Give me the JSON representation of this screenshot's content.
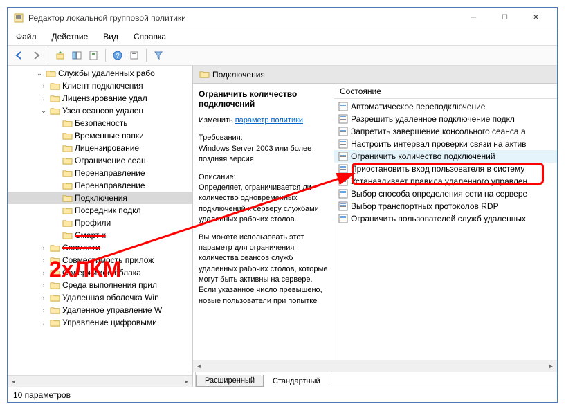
{
  "window": {
    "title": "Редактор локальной групповой политики"
  },
  "menu": {
    "file": "Файл",
    "action": "Действие",
    "view": "Вид",
    "help": "Справка"
  },
  "tree": {
    "root": "Службы удаленных рабо",
    "items": [
      "Клиент подключения",
      "Лицензирование удал",
      "Узел сеансов удален",
      "Безопасность",
      "Временные папки",
      "Лицензирование",
      "Ограничение сеан",
      "Перенаправление",
      "Перенаправление",
      "Подключения",
      "Посредник подкл",
      "Профили",
      "Смарт-к",
      "Совмести",
      "Совместимость прилож",
      "Содержимое облака",
      "Среда выполнения прил",
      "Удаленная оболочка Win",
      "Удаленное управление W",
      "Управление цифровыми"
    ],
    "sel_index": 9,
    "open_index": 2,
    "strike_a": 12,
    "strike_b": 13,
    "level2_start": 3,
    "level2_end": 12
  },
  "header": {
    "title": "Подключения"
  },
  "desc": {
    "title": "Ограничить количество подключений",
    "edit_label": "Изменить",
    "edit_link": "параметр политики",
    "req_h": "Требования:",
    "req_t": "Windows Server 2003 или более поздняя версия",
    "desc_h": "Описание:",
    "desc_t1": "Определяет, ограничивается ли количество одновременных подключений к серверу службами удаленных рабочих столов.",
    "desc_t2": "Вы можете использовать этот параметр для ограничения количества сеансов служб удаленных рабочих столов, которые могут быть активны на сервере. Если указанное число превышено, новые пользователи при попытке"
  },
  "list": {
    "col": "Состояние",
    "items": [
      "Автоматическое переподключение",
      "Разрешить удаленное подключение подкл",
      "Запретить завершение консольного сеанса а",
      "Настроить интервал проверки связи на актив",
      "Ограничить количество подключений",
      "Приостановить вход пользователя в систему",
      "Устанавливает правила удаленного управлен",
      "Выбор способа определения сети на сервере",
      "Выбор транспортных протоколов RDP",
      "Ограничить пользователей служб удаленных"
    ],
    "hl": 4
  },
  "tabs": {
    "ext": "Расширенный",
    "std": "Стандартный"
  },
  "status": "10 параметров",
  "annotation": "2xЛКМ"
}
